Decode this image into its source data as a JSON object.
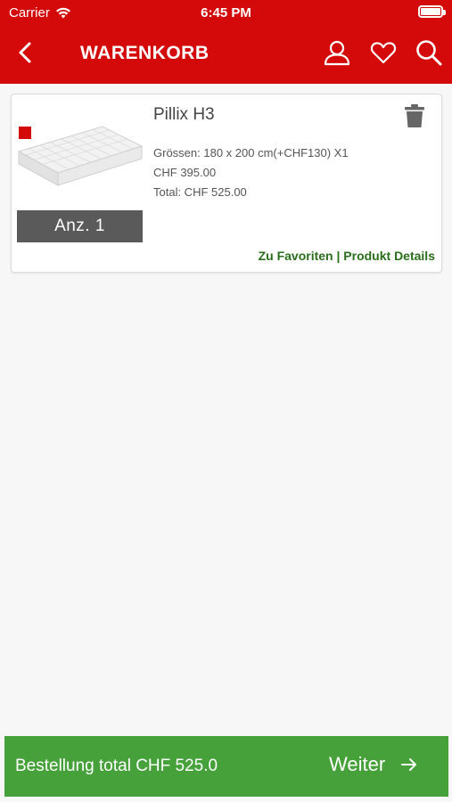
{
  "status_bar": {
    "carrier": "Carrier",
    "time": "6:45 PM"
  },
  "nav": {
    "title": "WARENKORB",
    "icons": [
      "back-arrow-icon",
      "user-icon",
      "heart-icon",
      "search-icon"
    ]
  },
  "cart": {
    "items": [
      {
        "name": "Pillix H3",
        "size_line": "Grössen: 180 x 200 cm(+CHF130) X1",
        "price_line": "CHF 395.00",
        "total_line": "Total: CHF 525.00",
        "quantity_label": "Anz. 1",
        "favorites_link": "Zu Favoriten",
        "separator": " | ",
        "details_link": "Produkt Details"
      }
    ]
  },
  "footer": {
    "total_label": "Bestellung total CHF 525.0",
    "next_label": "Weiter"
  },
  "colors": {
    "header": "#d40a0a",
    "footer": "#46a13a",
    "links": "#2a6e1c"
  }
}
